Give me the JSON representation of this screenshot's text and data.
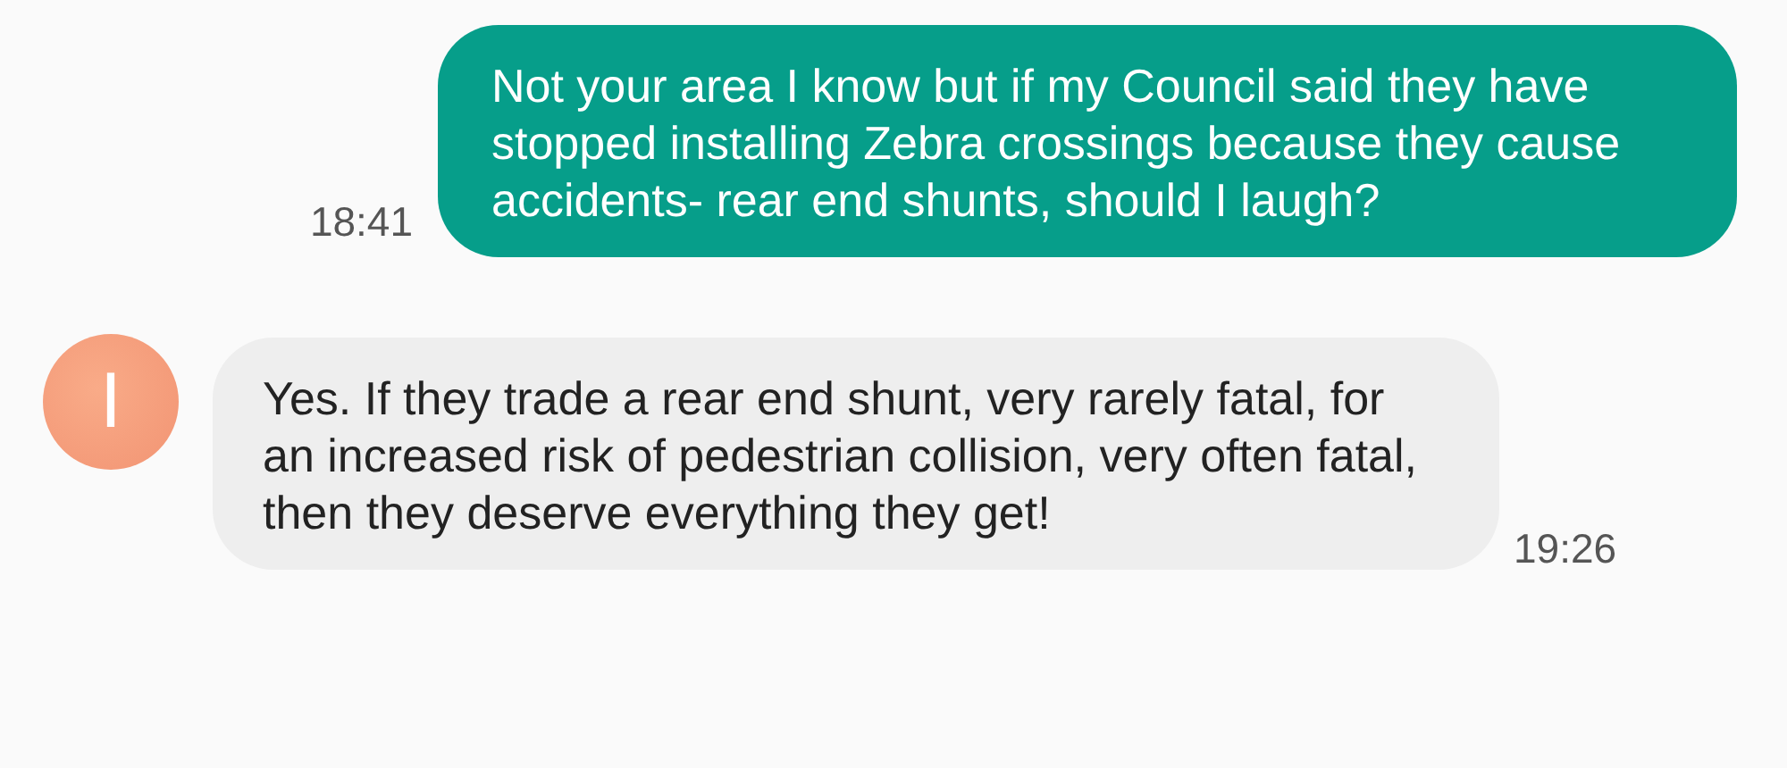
{
  "messages": [
    {
      "kind": "sent",
      "text": "Not your area I know but if my Council said they have stopped installing Zebra crossings because they cause accidents- rear end shunts, should I laugh?",
      "time": "18:41"
    },
    {
      "kind": "received",
      "avatar": "I",
      "text": "Yes. If they trade a rear end shunt, very rarely fatal, for an increased risk of pedestrian collision, very often fatal, then they deserve everything they get!",
      "time": "19:26"
    }
  ]
}
